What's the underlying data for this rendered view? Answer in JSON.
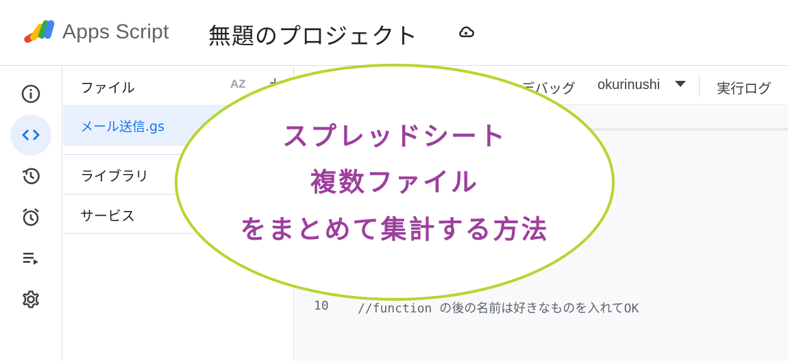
{
  "header": {
    "app_title": "Apps Script",
    "project_title": "無題のプロジェクト",
    "cloud_icon": "cloud-sync-icon"
  },
  "rail": {
    "items": [
      {
        "name": "overview",
        "icon": "info-icon",
        "active": false
      },
      {
        "name": "editor",
        "icon": "code-icon",
        "active": true
      },
      {
        "name": "versions",
        "icon": "history-icon",
        "active": false
      },
      {
        "name": "triggers",
        "icon": "alarm-icon",
        "active": false
      },
      {
        "name": "executions",
        "icon": "playlist-icon",
        "active": false
      },
      {
        "name": "settings",
        "icon": "gear-icon",
        "active": false
      }
    ]
  },
  "files": {
    "title": "ファイル",
    "sort_label": "AZ",
    "items": [
      {
        "name": "メール送信.gs",
        "selected": true
      }
    ],
    "sections": [
      {
        "label": "ライブラリ"
      },
      {
        "label": "サービス"
      }
    ]
  },
  "toolbar": {
    "debug_label": "デバッグ",
    "function_name": "okurinushi",
    "log_label": "実行ログ"
  },
  "code": {
    "lines": [
      {
        "number": "10",
        "text": "//function の後の名前は好きなものを入れてOK"
      }
    ]
  },
  "overlay": {
    "lines": [
      "スプレッドシート",
      "複数ファイル",
      "をまとめて集計する方法"
    ],
    "text_color": "#9c3f9e",
    "stroke_color": "#b5d631"
  },
  "colors": {
    "accent": "#1a73e8",
    "active_bg": "#e8f0fe"
  }
}
